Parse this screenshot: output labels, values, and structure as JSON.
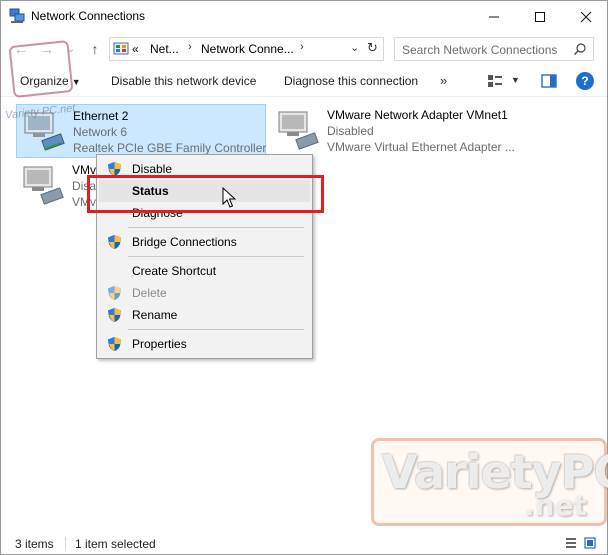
{
  "window": {
    "title": "Network Connections"
  },
  "address_bar": {
    "path": [
      "Net...",
      "Network Conne..."
    ],
    "overflow": "«",
    "search_placeholder": "Search Network Connections"
  },
  "toolbar": {
    "organize": "Organize",
    "disable_device": "Disable this network device",
    "diagnose": "Diagnose this connection",
    "more": "»"
  },
  "connections": [
    {
      "name": "Ethernet 2",
      "status": "Network 6",
      "device": "Realtek PCIe GBE Family Controller",
      "selected": true
    },
    {
      "name": "VMware Network Adapter VMnet1",
      "status": "Disabled",
      "device": "VMware Virtual Ethernet Adapter ...",
      "selected": false
    },
    {
      "name": "VMv",
      "status": "Disa",
      "device": "VMv",
      "selected": false
    }
  ],
  "context_menu": {
    "items": [
      {
        "label": "Disable",
        "shield": true,
        "disabled": false,
        "bold": false
      },
      {
        "label": "Status",
        "shield": false,
        "disabled": false,
        "bold": true,
        "hover": true
      },
      {
        "label": "Diagnose",
        "shield": false,
        "disabled": false,
        "bold": false
      },
      {
        "label": "Bridge Connections",
        "shield": true,
        "disabled": false,
        "bold": false
      },
      {
        "label": "Create Shortcut",
        "shield": false,
        "disabled": false,
        "bold": false
      },
      {
        "label": "Delete",
        "shield": true,
        "disabled": true,
        "bold": false
      },
      {
        "label": "Rename",
        "shield": true,
        "disabled": false,
        "bold": false
      },
      {
        "label": "Properties",
        "shield": true,
        "disabled": false,
        "bold": false
      }
    ]
  },
  "watermark": {
    "brand": "VarietyPC",
    "tld": ".net",
    "small": "Variety PC.net"
  },
  "status_bar": {
    "item_count": "3 items",
    "selection": "1 item selected"
  },
  "colors": {
    "selection_bg": "#cce8ff",
    "highlight_border": "#e02020",
    "help_blue": "#1a6fd0"
  }
}
